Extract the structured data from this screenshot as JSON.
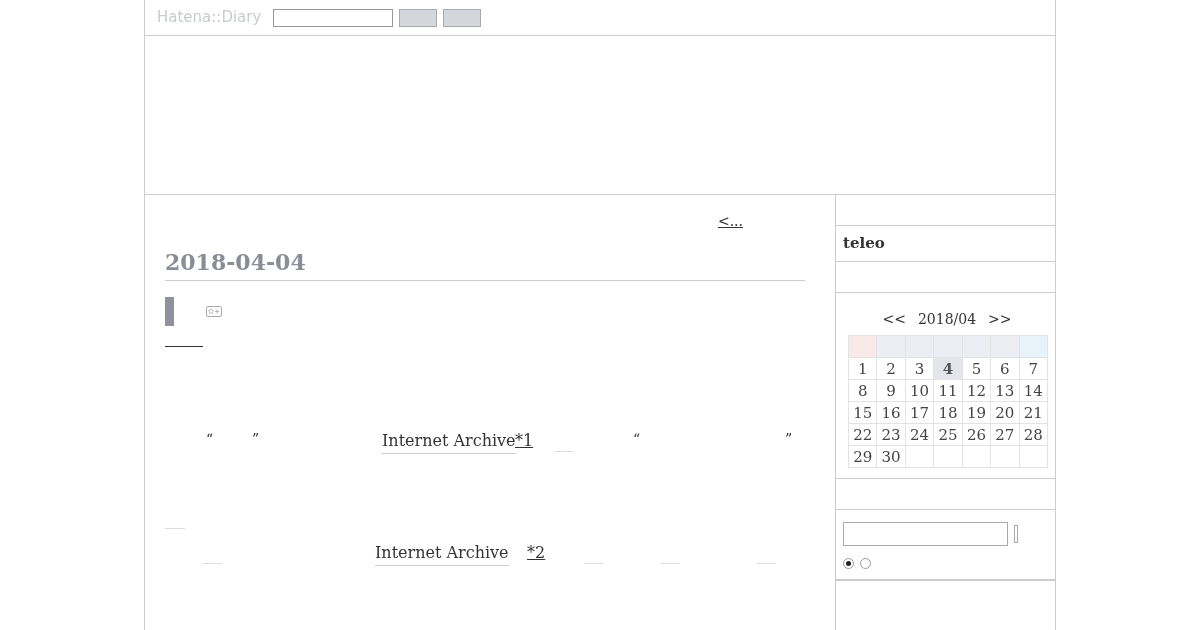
{
  "header": {
    "logo": "Hatena::Diary"
  },
  "main": {
    "pager_link": "<...",
    "date": "2018-04-04",
    "line_1": [
      {
        "kind": "quote",
        "text": "“"
      },
      {
        "kind": "quote",
        "text": "”"
      },
      {
        "kind": "link",
        "text": "Internet Archive"
      },
      {
        "kind": "footnote",
        "text": "*1"
      },
      {
        "kind": "quote",
        "text": "“"
      },
      {
        "kind": "quote",
        "text": "”"
      }
    ],
    "line_2": [
      {
        "kind": "link",
        "text": "Internet Archive"
      },
      {
        "kind": "footnote",
        "text": "*2"
      }
    ]
  },
  "sidebar": {
    "user": "teleo",
    "calendar": {
      "prev": "<<",
      "month": "2018/04",
      "next": ">>",
      "weekdays": [
        {
          "color": "#f8e8e8"
        },
        {
          "color": "#eceef3"
        },
        {
          "color": "#eceef3"
        },
        {
          "color": "#eceef3"
        },
        {
          "color": "#eceef3"
        },
        {
          "color": "#eceef3"
        },
        {
          "color": "#e6f3f9"
        }
      ],
      "days": [
        {
          "label": "1",
          "selected": false
        },
        {
          "label": "2",
          "selected": false
        },
        {
          "label": "3",
          "selected": false
        },
        {
          "label": "4",
          "selected": true
        },
        {
          "label": "5",
          "selected": false
        },
        {
          "label": "6",
          "selected": false
        },
        {
          "label": "7",
          "selected": false
        },
        {
          "label": "8",
          "selected": false
        },
        {
          "label": "9",
          "selected": false
        },
        {
          "label": "10",
          "selected": false
        },
        {
          "label": "11",
          "selected": false
        },
        {
          "label": "12",
          "selected": false
        },
        {
          "label": "13",
          "selected": false
        },
        {
          "label": "14",
          "selected": false
        },
        {
          "label": "15",
          "selected": false
        },
        {
          "label": "16",
          "selected": false
        },
        {
          "label": "17",
          "selected": false
        },
        {
          "label": "18",
          "selected": false
        },
        {
          "label": "19",
          "selected": false
        },
        {
          "label": "20",
          "selected": false
        },
        {
          "label": "21",
          "selected": false
        },
        {
          "label": "22",
          "selected": false
        },
        {
          "label": "23",
          "selected": false
        },
        {
          "label": "24",
          "selected": false
        },
        {
          "label": "25",
          "selected": false
        },
        {
          "label": "26",
          "selected": false
        },
        {
          "label": "27",
          "selected": false
        },
        {
          "label": "28",
          "selected": false
        },
        {
          "label": "29",
          "selected": false
        },
        {
          "label": "30",
          "selected": false
        }
      ]
    },
    "search_scope": [
      {
        "selected": true
      },
      {
        "selected": false
      }
    ]
  }
}
